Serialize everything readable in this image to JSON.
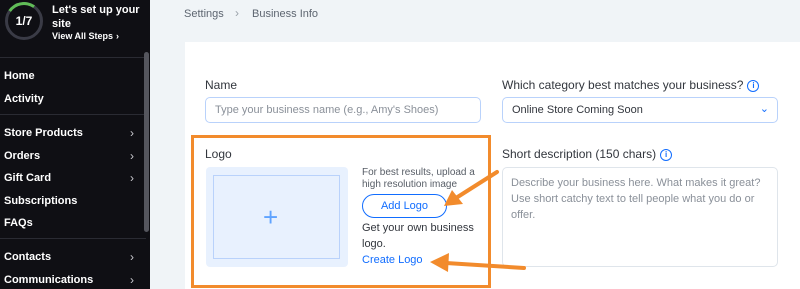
{
  "setup": {
    "progress_text": "1/7",
    "progress_fraction": 0.14,
    "title": "Let's set up your site",
    "link": "View All Steps",
    "link_icon": "chevron-right-icon"
  },
  "sidebar": {
    "items": [
      {
        "label": "Home",
        "has_arrow": false
      },
      {
        "label": "Activity",
        "has_arrow": false
      },
      {
        "label": "Store Products",
        "has_arrow": true
      },
      {
        "label": "Orders",
        "has_arrow": true
      },
      {
        "label": "Gift Card",
        "has_arrow": true
      },
      {
        "label": "Subscriptions",
        "has_arrow": false
      },
      {
        "label": "FAQs",
        "has_arrow": false
      },
      {
        "label": "Contacts",
        "has_arrow": true
      },
      {
        "label": "Communications",
        "has_arrow": true
      }
    ],
    "arrow_glyph": "›"
  },
  "breadcrumb": {
    "items": [
      "Settings",
      "Business Info"
    ],
    "separator": "›"
  },
  "form": {
    "name_label": "Name",
    "name_placeholder": "Type your business name (e.g., Amy's Shoes)",
    "category_label": "Which category best matches your business?",
    "category_value": "Online Store Coming Soon",
    "logo_label": "Logo",
    "logo_hint": "For best results, upload a high resolution image",
    "add_logo_label": "Add Logo",
    "own_logo_text": "Get your own business logo.",
    "create_logo_label": "Create Logo",
    "short_desc_label": "Short description (150 chars)",
    "short_desc_placeholder": "Describe your business here. What makes it great? Use short catchy text to tell people what you do or offer.",
    "info_glyph": "i"
  },
  "colors": {
    "sidebar_bg": "#0f0f14",
    "accent": "#116dff",
    "highlight": "#f28b2c",
    "progress": "#60bc57"
  }
}
